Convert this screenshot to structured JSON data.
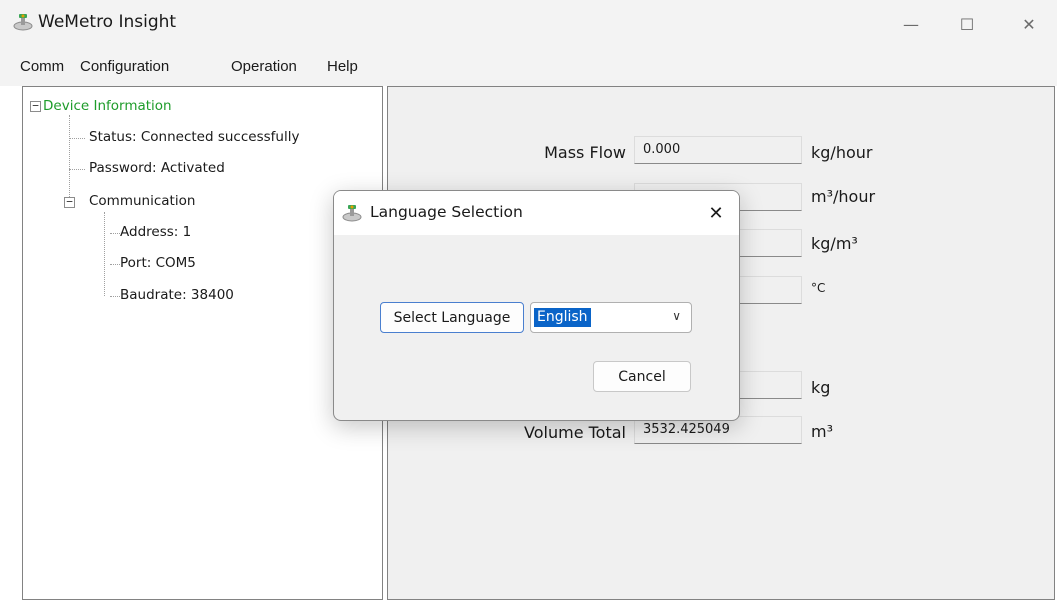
{
  "window": {
    "title": "WeMetro Insight",
    "app_icon": "wemetro-app-icon",
    "controls": {
      "minimize": "—",
      "maximize": "☐",
      "close": "✕"
    }
  },
  "menu": {
    "items": [
      "Comm",
      "Configuration",
      "Operation",
      "Help"
    ]
  },
  "tree": {
    "root": {
      "label": "Device Information",
      "expanded_symbol": "−"
    },
    "status": "Status: Connected successfully",
    "password": "Password: Activated",
    "communication": {
      "label": "Communication",
      "expanded_symbol": "−"
    },
    "address": "Address: 1",
    "port": "Port: COM5",
    "baudrate": "Baudrate: 38400"
  },
  "fields": [
    {
      "label": "Mass Flow",
      "value": "0.000",
      "unit": "kg/hour"
    },
    {
      "label": "",
      "value": "",
      "unit": "m³/hour"
    },
    {
      "label": "",
      "value": "",
      "unit": "kg/m³"
    },
    {
      "label": "",
      "value": "",
      "unit": "°C"
    },
    {
      "label": "",
      "value": "",
      "unit": "kg"
    },
    {
      "label": "Volume Total",
      "value": "3532.425049",
      "unit": "m³"
    }
  ],
  "dialog": {
    "title": "Language Selection",
    "icon": "wemetro-app-icon",
    "close": "✕",
    "select_button": "Select Language",
    "language_value": "English",
    "dropdown_arrow": "∨",
    "cancel_button": "Cancel"
  },
  "colors": {
    "tree_root": "#1e9c2a",
    "selection": "#0a64c8",
    "pane_bg": "#f0f0f0"
  }
}
